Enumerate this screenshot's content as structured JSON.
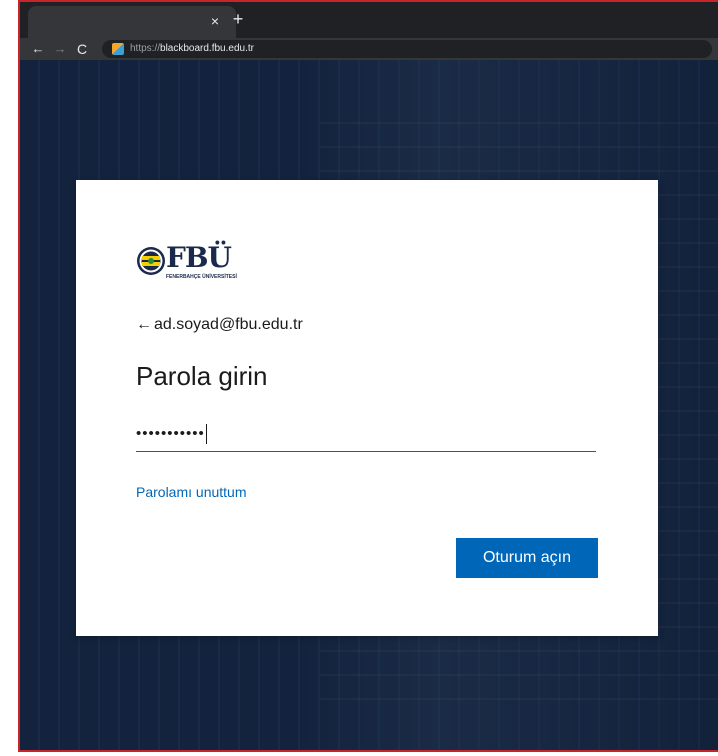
{
  "browser": {
    "tab_close": "×",
    "new_tab": "+",
    "nav": {
      "back": "←",
      "forward": "→",
      "reload": "C"
    },
    "url_scheme": "https://",
    "url_host": "blackboard.fbu.edu.tr"
  },
  "login": {
    "logo_text": "FBÜ",
    "logo_subtext": "FENERBAHÇE ÜNİVERSİTESİ",
    "back_arrow": "←",
    "identity": "ad.soyad@fbu.edu.tr",
    "title": "Parola girin",
    "password_masked": "•••••••••••",
    "forgot_link": "Parolamı unuttum",
    "submit_label": "Oturum açın"
  },
  "colors": {
    "accent": "#0067b8",
    "frame_border": "#c8242a",
    "background": "#0f1d33"
  }
}
